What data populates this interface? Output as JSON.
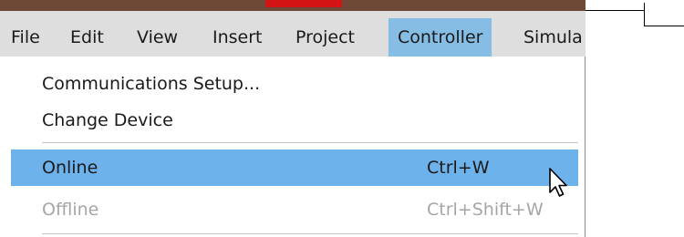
{
  "menubar": {
    "items": [
      {
        "label": "File"
      },
      {
        "label": "Edit"
      },
      {
        "label": "View"
      },
      {
        "label": "Insert"
      },
      {
        "label": "Project"
      },
      {
        "label": "Controller",
        "active": true
      },
      {
        "label": "Simula"
      }
    ]
  },
  "dropdown": {
    "items": [
      {
        "label": "Communications Setup...",
        "shortcut": ""
      },
      {
        "label": "Change Device",
        "shortcut": ""
      },
      {
        "label": "Online",
        "shortcut": "Ctrl+W",
        "highlighted": true
      },
      {
        "label": "Offline",
        "shortcut": "Ctrl+Shift+W",
        "disabled": true
      }
    ]
  },
  "colors": {
    "title_strip": "#6e4a36",
    "title_accent": "#d41414",
    "menubar_bg": "#dedede",
    "menubar_active": "#86bde5",
    "item_highlight": "#6eb2ec",
    "disabled_text": "#a6a6a6"
  },
  "icons": {
    "cursor": "mouse-pointer-icon"
  }
}
